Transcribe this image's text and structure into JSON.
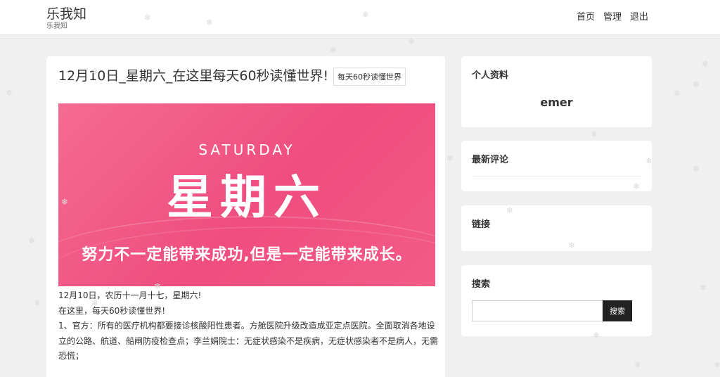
{
  "site": {
    "title": "乐我知",
    "subtitle": "乐我知"
  },
  "nav": [
    {
      "label": "首页"
    },
    {
      "label": "管理"
    },
    {
      "label": "退出"
    }
  ],
  "post": {
    "title": "12月10日_星期六_在这里每天60秒读懂世界!",
    "tag": "每天60秒读懂世界",
    "banner": {
      "en": "SATURDAY",
      "cn": "星期六",
      "quote": "努力不一定能带来成功,但是一定能带来成长。"
    },
    "paragraphs": [
      "12月10日，农历十一月十七，星期六!",
      "在这里，每天60秒读懂世界!",
      "1、官方：所有的医疗机构都要接诊核酸阳性患者。方舱医院升级改造成亚定点医院。全面取消各地设立的公路、航道、船闸防疫检查点；李兰娟院士：无症状感染不是疾病，无症状感染者不是病人，无需恐慌；"
    ]
  },
  "sidebar": {
    "profile": {
      "heading": "个人资料",
      "name": "emer"
    },
    "comments": {
      "heading": "最新评论"
    },
    "links": {
      "heading": "链接"
    },
    "search": {
      "heading": "搜索",
      "button": "搜索",
      "placeholder": ""
    }
  },
  "icons": {
    "decor": "snowflake-icon",
    "glyph": "❄"
  }
}
